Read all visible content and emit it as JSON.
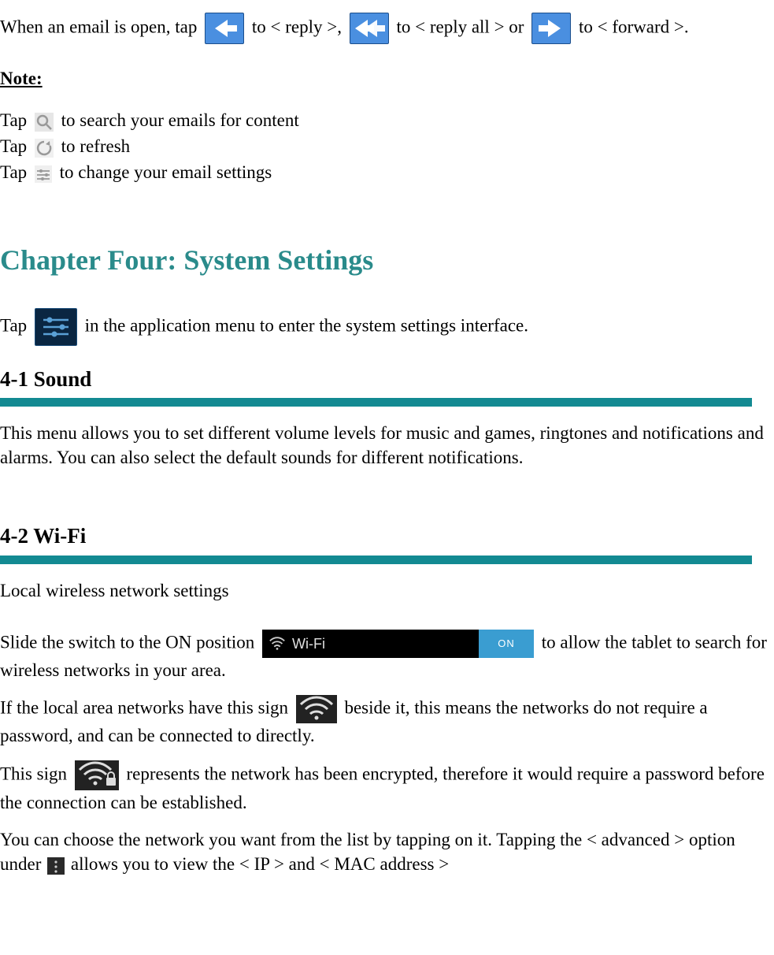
{
  "paraEmail": {
    "t1": "When an email is open, tap ",
    "t2": " to < reply >, ",
    "t3": " to < reply all > or ",
    "t4": " to < forward >."
  },
  "note": {
    "heading": "Note:"
  },
  "tapLines": {
    "l1a": "Tap ",
    "l1b": " to search your emails for content",
    "l2a": "Tap ",
    "l2b": " to refresh",
    "l3a": "Tap ",
    "l3b": " to change your email settings"
  },
  "chapter": {
    "title": "Chapter Four: System Settings"
  },
  "chapterTap": {
    "a": "Tap ",
    "b": " in the application menu to enter the system settings interface."
  },
  "section41": {
    "heading": "4-1 Sound",
    "body": "This menu allows you to set different volume levels for music and games, ringtones and notifications and alarms.    You can also select the default sounds for different notifications."
  },
  "section42": {
    "heading": "4-2 Wi-Fi",
    "sub": "Local wireless network settings",
    "p1a": "Slide the switch to the ON position ",
    "p1b": " to allow the tablet to search for wireless networks in your area.",
    "p2a": "If the local area networks have this sign ",
    "p2b": " beside it, this means the networks do not require a password, and can be connected to directly.",
    "p3a": "This sign ",
    "p3b": " represents the network has been encrypted, therefore it would require a password before the connection can be established.",
    "p4a": "You can choose the network you want from the list by tapping on it. Tapping the < advanced > option under ",
    "p4b": " allows you to view the < IP > and < MAC address >"
  },
  "wifiSwitch": {
    "label": "Wi-Fi",
    "state": "ON"
  }
}
